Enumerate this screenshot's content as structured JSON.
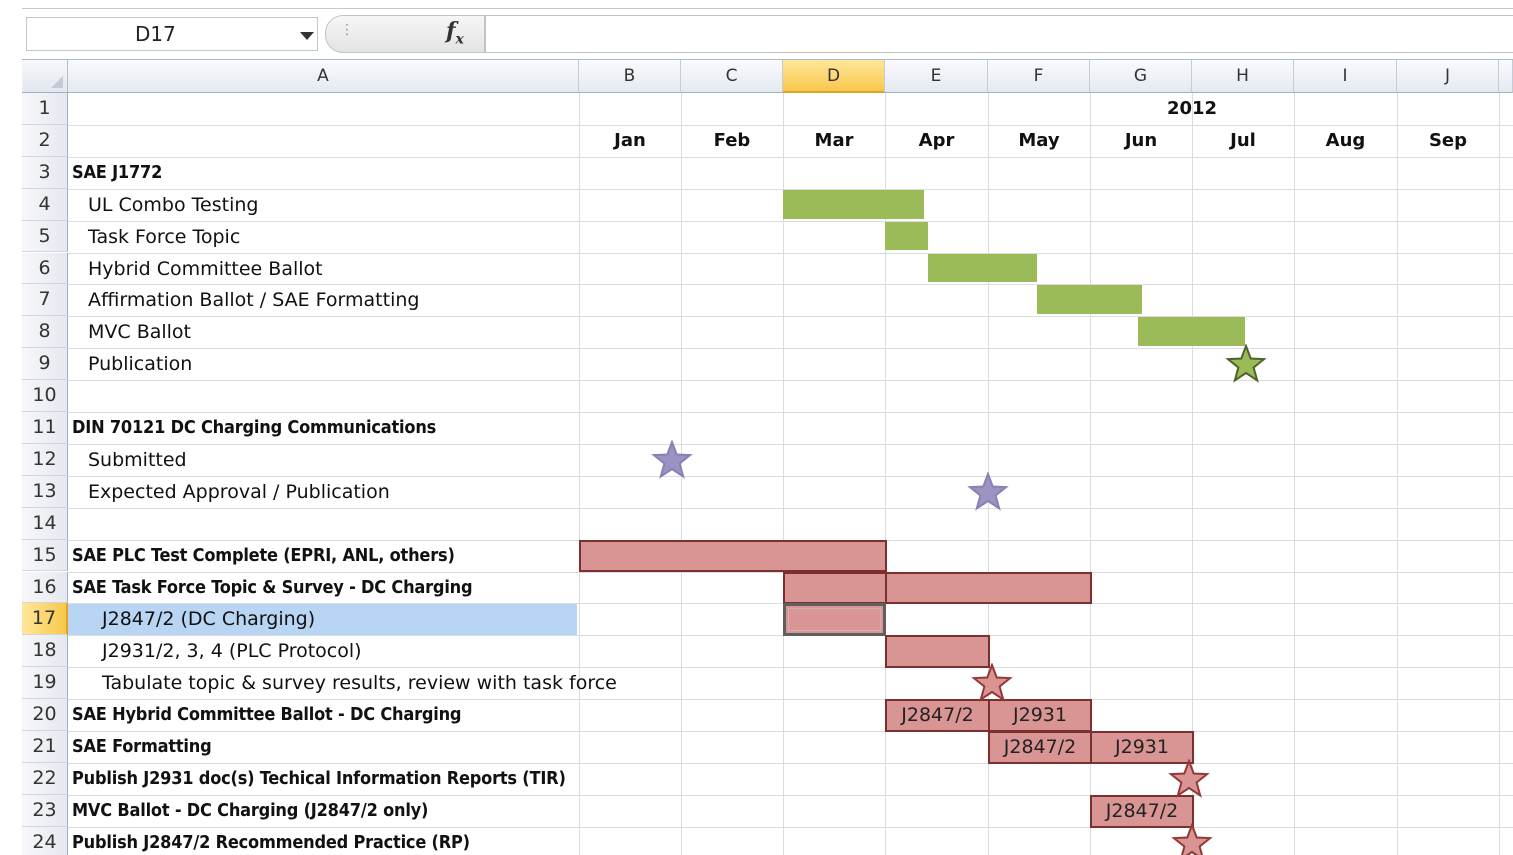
{
  "formula_bar": {
    "name_box": "D17",
    "fx": "fx"
  },
  "columns": [
    "A",
    "B",
    "C",
    "D",
    "E",
    "F",
    "G",
    "H",
    "I",
    "J"
  ],
  "rows": [
    "1",
    "2",
    "3",
    "4",
    "5",
    "6",
    "7",
    "8",
    "9",
    "10",
    "11",
    "12",
    "13",
    "14",
    "15",
    "16",
    "17",
    "18",
    "19",
    "20",
    "21",
    "22",
    "23",
    "24"
  ],
  "year": "2012",
  "months": [
    "Jan",
    "Feb",
    "Mar",
    "Apr",
    "May",
    "Jun",
    "Jul",
    "Aug",
    "Sep"
  ],
  "labels": {
    "r3": "SAE J1772",
    "r4": "UL Combo Testing",
    "r5": "Task Force Topic",
    "r6": "Hybrid Committee Ballot",
    "r7": "Affirmation Ballot / SAE Formatting",
    "r8": "MVC Ballot",
    "r9": "Publication",
    "r11": "DIN 70121 DC Charging Communications",
    "r12": "Submitted",
    "r13": "Expected Approval / Publication",
    "r15": "SAE PLC Test Complete (EPRI, ANL, others)",
    "r16": "SAE Task Force Topic & Survey - DC Charging",
    "r17": "J2847/2 (DC Charging)",
    "r18": "J2931/2, 3, 4 (PLC Protocol)",
    "r19": "Tabulate topic & survey results, review with task force",
    "r20": "SAE Hybrid Committee Ballot - DC Charging",
    "r21": "SAE Formatting",
    "r22": "Publish J2931 doc(s) Techical Information Reports (TIR)",
    "r23": "MVC Ballot - DC Charging  (J2847/2 only)",
    "r24": "Publish J2847/2 Recommended Practice (RP)"
  },
  "bar_labels": {
    "r20_e": "J2847/2",
    "r20_f": "J2931",
    "r21_f": "J2847/2",
    "r21_g": "J2931",
    "r23_g": "J2847/2"
  },
  "colors": {
    "green_bar": "#9bbb59",
    "red_bar": "#d99594",
    "red_border": "#7b2f2f",
    "purple_star": "#9d93c2",
    "selection": "#b8d5f3",
    "header_selected": "#f8c84c"
  }
}
